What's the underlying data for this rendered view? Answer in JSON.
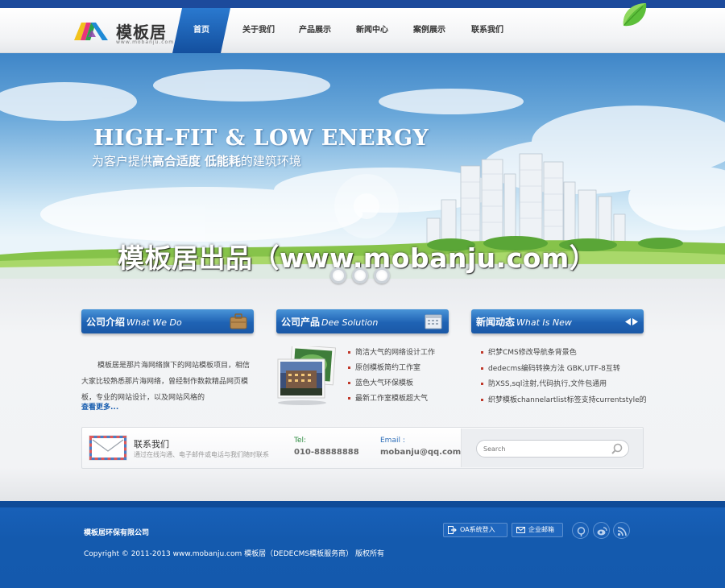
{
  "header": {
    "logo_text": "模板居",
    "logo_url": "www.mobanju.com",
    "nav": [
      {
        "label": "首页",
        "active": true
      },
      {
        "label": "关于我们",
        "active": false
      },
      {
        "label": "产品展示",
        "active": false
      },
      {
        "label": "新闻中心",
        "active": false
      },
      {
        "label": "案例展示",
        "active": false
      },
      {
        "label": "联系我们",
        "active": false
      }
    ]
  },
  "banner": {
    "title": "HIGH-FIT & LOW ENERGY",
    "subtitle_a": "为客户提供",
    "subtitle_b": "高合适度",
    "subtitle_c": "低能耗",
    "subtitle_d": "的建筑环境",
    "watermark": "模板居出品（www.mobanju.com）",
    "slide_count": 3
  },
  "about": {
    "title_cn": "公司介绍",
    "title_en": "What We Do",
    "text": "模板居是那片海网络旗下的网站模板项目，相信大家比较熟悉那片海网络，曾经制作数款精品网页模板，专业的网站设计，以及网站风格的",
    "more": "查看更多..."
  },
  "products": {
    "title_cn": "公司产品",
    "title_en": "Dee Solution",
    "items": [
      "简洁大气的网络设计工作",
      "原创模板简约工作室",
      "蓝色大气环保模板",
      "最新工作室模板超大气"
    ]
  },
  "news": {
    "title_cn": "新闻动态",
    "title_en": "What Is New",
    "items": [
      "织梦CMS修改导航条背景色",
      "dedecms编码转换方法 GBK,UTF-8互转",
      "防XSS,sql注射,代码执行,文件包通用",
      "织梦模板channelartlist标签支持currentstyle的"
    ]
  },
  "contact": {
    "title": "联系我们",
    "desc": "通过在线沟通、电子邮件或电话与我们随时联系",
    "tel_label": "Tel:",
    "tel": "010-88888888",
    "email_label": "Email :",
    "email": "mobanju@qq.com",
    "search_placeholder": "Search"
  },
  "footer": {
    "company": "模板居环保有限公司",
    "copyright": "Copyright © 2011-2013 www.mobanju.com 模板居（DEDECMS模板服务商） 版权所有",
    "oa_login": "OA系统登入",
    "company_mail": "企业邮箱"
  },
  "colors": {
    "brand_blue": "#1f63b4",
    "footer_blue": "#1459ad",
    "bullet_red": "#c0392b"
  }
}
